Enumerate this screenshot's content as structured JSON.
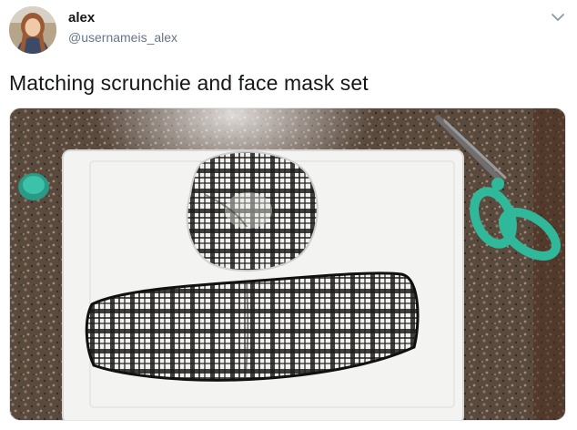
{
  "user": {
    "display_name": "alex",
    "handle": "@usernameis_alex"
  },
  "tweet": {
    "text": "Matching scrunchie and face mask set"
  },
  "icons": {
    "menu": "chevron-down-icon"
  },
  "colors": {
    "text_primary": "#14171a",
    "text_secondary": "#657786",
    "scissors_handle": "#2fb89a",
    "countertop": "#5b4a3c"
  }
}
